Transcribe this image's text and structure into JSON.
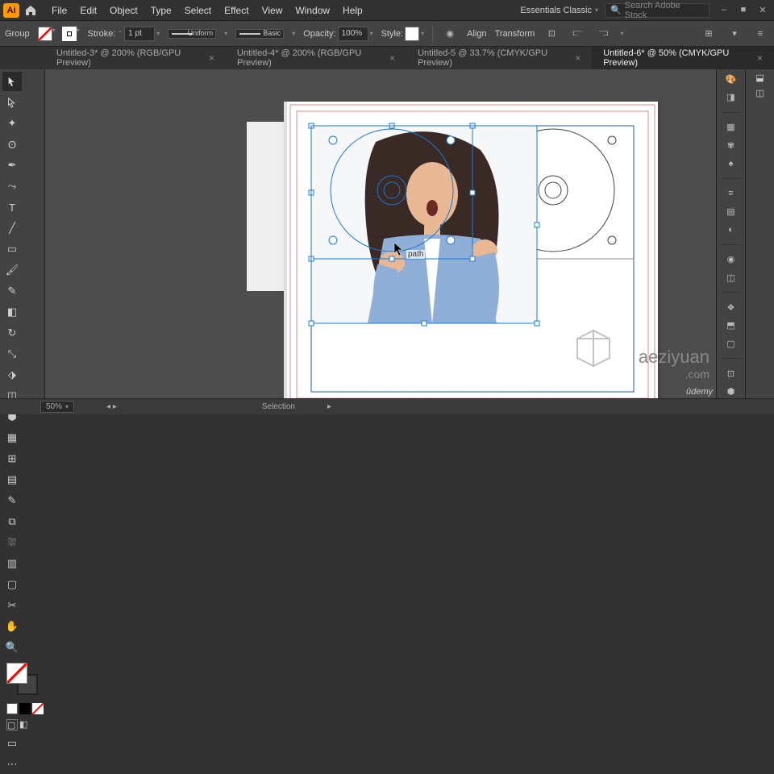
{
  "app": {
    "logo": "Ai"
  },
  "menu": [
    "File",
    "Edit",
    "Object",
    "Type",
    "Select",
    "Effect",
    "View",
    "Window",
    "Help"
  ],
  "workspace_label": "Essentials Classic",
  "search_placeholder": "Search Adobe Stock",
  "ctrlbar": {
    "group_label": "Group",
    "stroke_label": "Stroke:",
    "stroke_weight": "1 pt",
    "profile1": "Uniform",
    "profile2": "Basic",
    "opacity_label": "Opacity:",
    "opacity_value": "100%",
    "style_label": "Style:",
    "align_label": "Align",
    "transform_label": "Transform"
  },
  "tabs": [
    {
      "label": "Untitled-3* @ 200% (RGB/GPU Preview)",
      "active": false
    },
    {
      "label": "Untitled-4* @ 200% (RGB/GPU Preview)",
      "active": false
    },
    {
      "label": "Untitled-5 @ 33.7% (CMYK/GPU Preview)",
      "active": false
    },
    {
      "label": "Untitled-6* @ 50% (CMYK/GPU Preview)",
      "active": true
    }
  ],
  "status": {
    "zoom": "50%",
    "tool": "Selection"
  },
  "cursor_label": "path",
  "watermark": {
    "line1": "aeziyuan",
    "line2": ".com",
    "brand": "ûdemy"
  }
}
